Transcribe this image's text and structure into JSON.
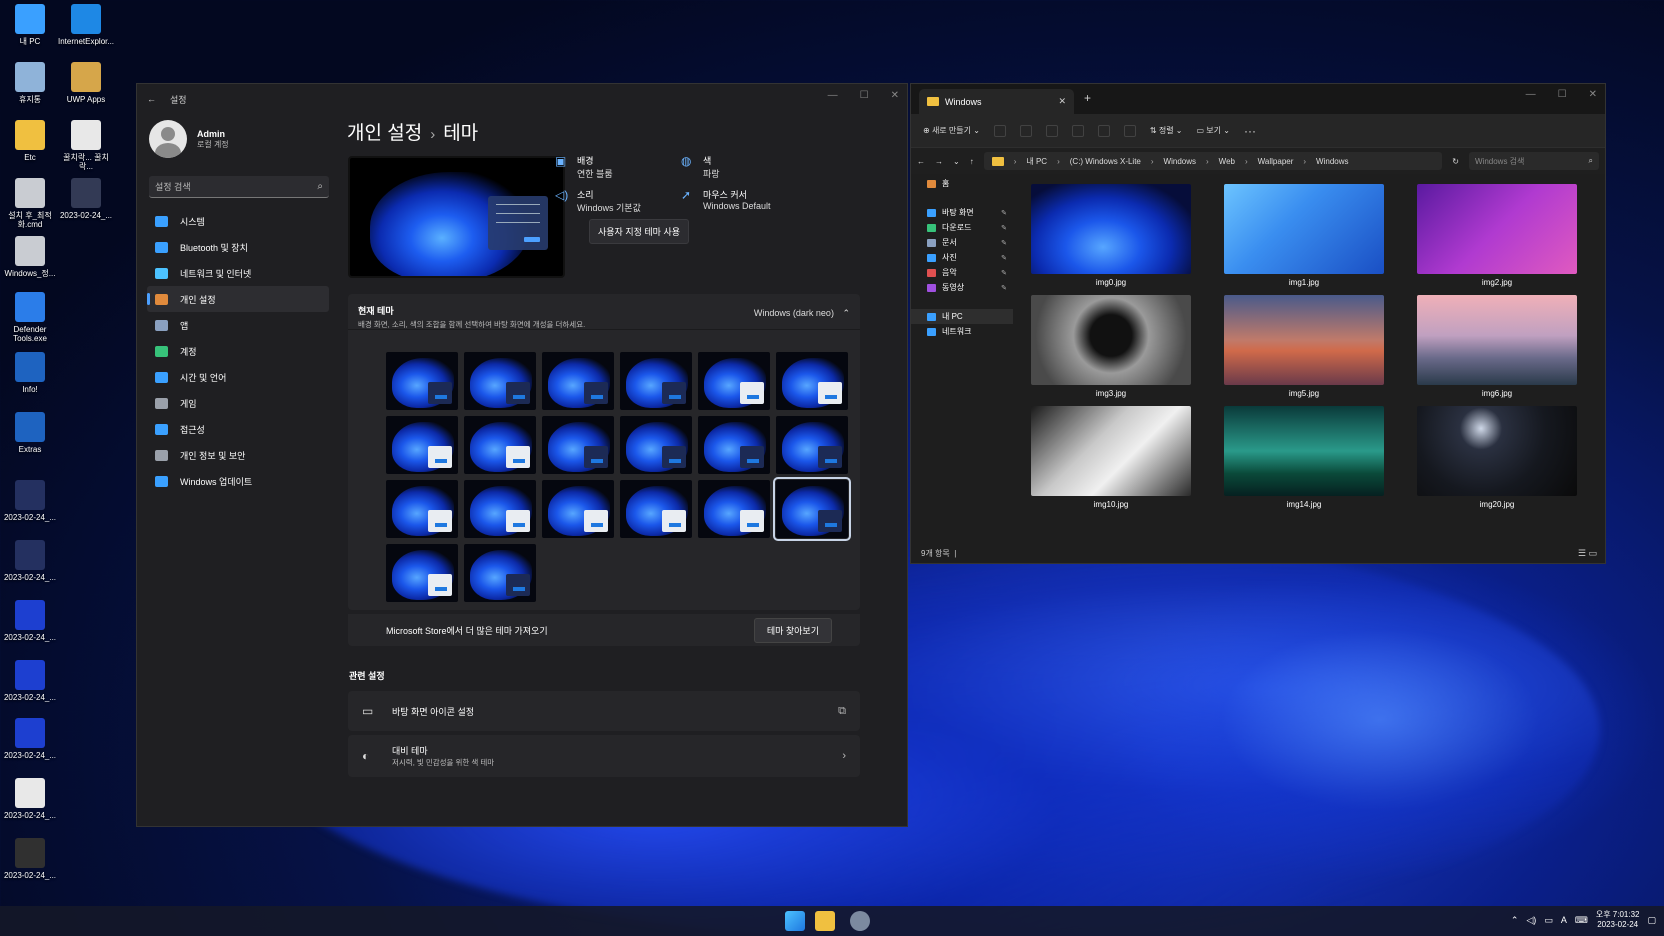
{
  "desktop": {
    "icons": [
      {
        "label": "내 PC"
      },
      {
        "label": "InternetExplor..."
      },
      {
        "label": "휴지통"
      },
      {
        "label": "UWP Apps"
      },
      {
        "label": "Etc"
      },
      {
        "label": "꿀치락... 꿀치락..."
      },
      {
        "label": "설치 후_최적화.cmd"
      },
      {
        "label": "2023-02-24_..."
      },
      {
        "label": "Windows_정..."
      },
      {
        "label": "Defender Tools.exe"
      },
      {
        "label": "Info!"
      },
      {
        "label": "Extras"
      },
      {
        "label": "2023-02-24_..."
      },
      {
        "label": "2023-02-24_..."
      },
      {
        "label": "2023-02-24_..."
      },
      {
        "label": "2023-02-24_..."
      },
      {
        "label": "2023-02-24_..."
      },
      {
        "label": "2023-02-24_..."
      },
      {
        "label": "2023-02-24_..."
      }
    ]
  },
  "settings": {
    "window_title": "설정",
    "user": {
      "name": "Admin",
      "sub": "로컬 계정"
    },
    "search": {
      "placeholder": "설정 검색"
    },
    "nav": [
      {
        "label": "시스템",
        "color": "#3aa0ff"
      },
      {
        "label": "Bluetooth 및 장치",
        "color": "#3aa0ff"
      },
      {
        "label": "네트워크 및 인터넷",
        "color": "#4cc2ff"
      },
      {
        "label": "개인 설정",
        "color": "#e08a3c"
      },
      {
        "label": "앱",
        "color": "#8aa0c0"
      },
      {
        "label": "계정",
        "color": "#37c27a"
      },
      {
        "label": "시간 및 언어",
        "color": "#3aa0ff"
      },
      {
        "label": "게임",
        "color": "#9aa0aa"
      },
      {
        "label": "접근성",
        "color": "#3aa0ff"
      },
      {
        "label": "개인 정보 및 보안",
        "color": "#9aa0aa"
      },
      {
        "label": "Windows 업데이트",
        "color": "#3aa0ff"
      }
    ],
    "title": {
      "parent": "개인 설정",
      "sep": "›",
      "current": "테마"
    },
    "quick": {
      "background": {
        "label": "배경",
        "value": "연한 블룸"
      },
      "color": {
        "label": "색",
        "value": "파랑"
      },
      "sound": {
        "label": "소리",
        "value": "Windows 기본값"
      },
      "cursor": {
        "label": "마우스 커서",
        "value": "Windows Default"
      },
      "custom_button": "사용자 지정 테마 사용"
    },
    "current_theme": {
      "title": "현재 테마",
      "desc": "배경 화면, 소리, 색의 조합을 함께 선택하여 바탕 화면에 개성을 더하세요.",
      "value": "Windows (dark neo)",
      "selected_index": 17,
      "thumb_count": 20
    },
    "store": {
      "text": "Microsoft Store에서 더 많은 테마 가져오기",
      "button": "테마 찾아보기"
    },
    "related": {
      "title": "관련 설정",
      "desktop_icons": "바탕 화면 아이콘 설정",
      "contrast": {
        "label": "대비 테마",
        "sub": "저시력, 빛 민감성을 위한 색 테마"
      }
    }
  },
  "explorer": {
    "tab_title": "Windows",
    "toolbar": {
      "new": "새로 만들기",
      "sort": "정렬",
      "view": "보기"
    },
    "breadcrumb": [
      "내 PC",
      "(C:) Windows X-Lite",
      "Windows",
      "Web",
      "Wallpaper",
      "Windows"
    ],
    "search_placeholder": "Windows 검색",
    "side": {
      "home": "홈",
      "pinned": [
        "바탕 화면",
        "다운로드",
        "문서",
        "사진",
        "음악",
        "동영상"
      ],
      "this_pc": "내 PC",
      "network": "네트워크"
    },
    "files": [
      {
        "name": "img0.jpg"
      },
      {
        "name": "img1.jpg"
      },
      {
        "name": "img2.jpg"
      },
      {
        "name": "img3.jpg"
      },
      {
        "name": "img5.jpg"
      },
      {
        "name": "img6.jpg"
      },
      {
        "name": "img10.jpg"
      },
      {
        "name": "img14.jpg"
      },
      {
        "name": "img20.jpg"
      }
    ],
    "status": "9개 항목"
  },
  "taskbar": {
    "time": "오후 7:01:32",
    "date": "2023-02-24",
    "ime": "A"
  }
}
